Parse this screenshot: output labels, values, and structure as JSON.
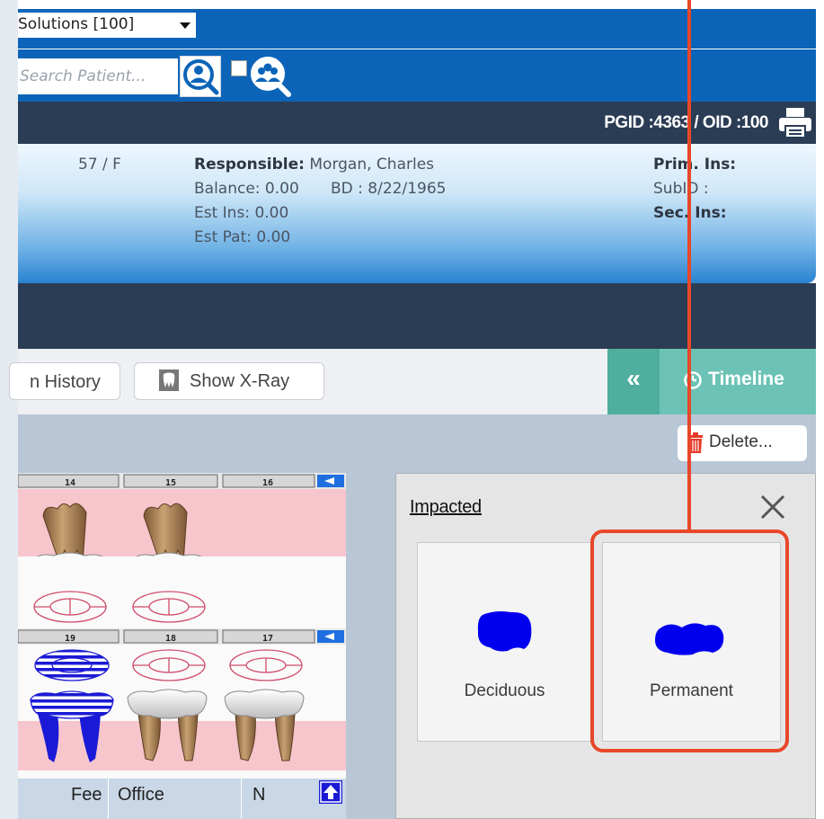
{
  "practice": {
    "selected": "Solutions [100]"
  },
  "search": {
    "placeholder": "Search Patient..."
  },
  "ids": {
    "text": "PGID :4363  /  OID :100"
  },
  "patient": {
    "age_sex": "57 / F",
    "responsible_label": "Responsible:",
    "responsible_value": "Morgan, Charles",
    "balance": "Balance: 0.00",
    "bd": "BD : 8/22/1965",
    "est_ins": "Est Ins:  0.00",
    "est_pat": "Est Pat: 0.00",
    "prim_ins_label": "Prim. Ins:",
    "subid_label": "SubID :",
    "sec_ins_label": "Sec. Ins:"
  },
  "toolbar": {
    "history_label": "n History",
    "xray_label": "Show X-Ray",
    "collapse_label": "«",
    "timeline_label": "Timeline",
    "delete_label": "Delete..."
  },
  "tooth_chart": {
    "upper_numbers": [
      "14",
      "15",
      "16"
    ],
    "lower_numbers": [
      "19",
      "18",
      "17"
    ]
  },
  "fee_table": {
    "columns": [
      "Fee",
      "Office",
      "N"
    ]
  },
  "popup": {
    "title": "Impacted",
    "options": [
      "Deciduous",
      "Permanent"
    ]
  },
  "colors": {
    "top_blue": "#0b64b8",
    "dark_navy": "#2b3d55",
    "teal": "#6cc3b5",
    "teal_dark": "#4fae9d",
    "annotation": "#e8472a",
    "impacted_blob": "#0000ee",
    "gum_pink": "#f7c5cc"
  },
  "icons": [
    "search-patient-icon",
    "group-search-icon",
    "print-icon",
    "xray-icon",
    "clock-icon",
    "trash-icon",
    "close-icon",
    "arrow-up-icon",
    "arrow-left-icon"
  ]
}
